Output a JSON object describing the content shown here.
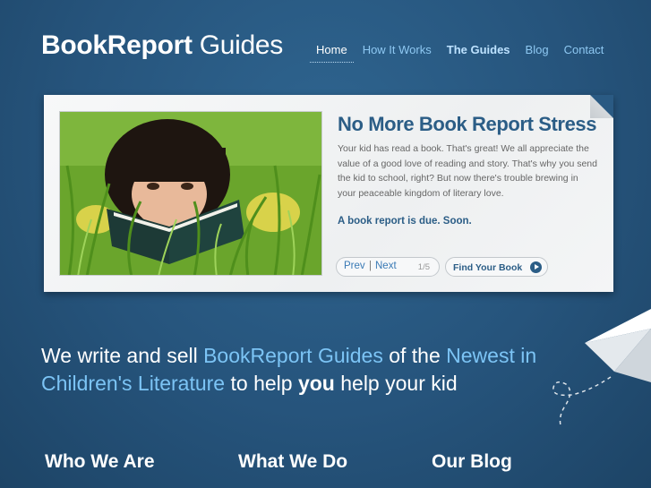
{
  "site": {
    "logo_bold": "BookReport",
    "logo_light": "Guides"
  },
  "nav": {
    "items": [
      {
        "label": "Home"
      },
      {
        "label": "How It Works"
      },
      {
        "label": "The Guides"
      },
      {
        "label": "Blog"
      },
      {
        "label": "Contact"
      }
    ]
  },
  "slider": {
    "headline": "No More Book Report Stress",
    "body": "Your kid has read a book. That's great! We all appreciate the value of a good love of reading and story. That's why you send the kid to school, right? But now there's trouble brewing in your peaceable kingdom of literary love.",
    "emphasis": "A book report is due. Soon.",
    "prev_label": "Prev",
    "separator": "|",
    "next_label": "Next",
    "counter": "1/5",
    "cta_label": "Find Your Book",
    "image_icon": "child-reading-in-grass-photo"
  },
  "tagline": {
    "part1": "We write and sell ",
    "hl1": "BookReport Guides",
    "part2": " of the ",
    "hl2": "Newest in Children's Literature",
    "part3": " to help ",
    "bold": "you",
    "part4": " help your kid"
  },
  "sections": {
    "who": "Who We Are",
    "what": "What We Do",
    "blog": "Our Blog"
  },
  "colors": {
    "background": "#26547c",
    "accent": "#7cc4f5",
    "heading": "#2b5d86"
  }
}
